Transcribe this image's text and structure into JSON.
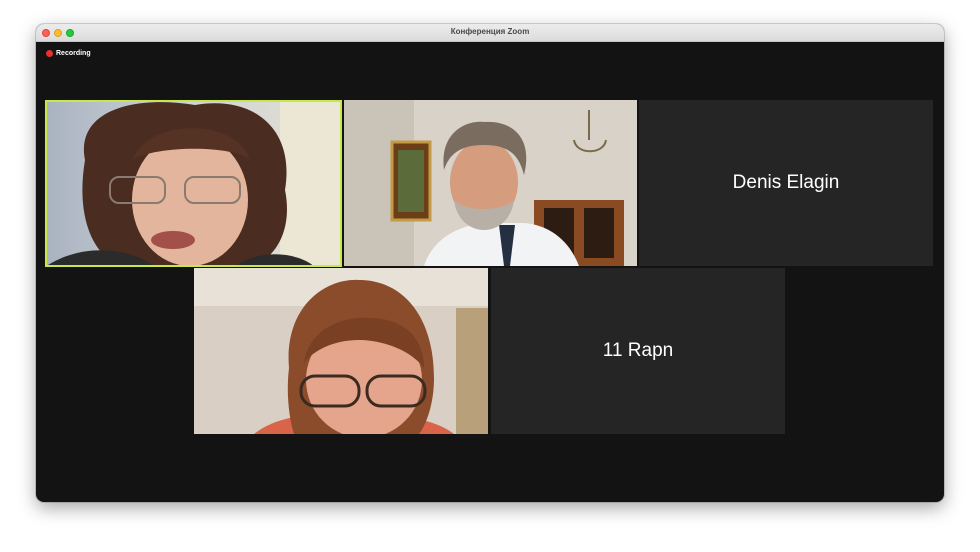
{
  "window": {
    "title": "Конференция Zoom"
  },
  "recording": {
    "label": "Recording",
    "color": "#e5322d"
  },
  "participants": [
    {
      "kind": "video",
      "active": true
    },
    {
      "kind": "video",
      "active": false
    },
    {
      "kind": "name",
      "name": "Denis Elagin"
    },
    {
      "kind": "video",
      "active": false
    },
    {
      "kind": "name",
      "name": "11 Rapn"
    }
  ],
  "colors": {
    "active_speaker_border": "#c8e84a",
    "name_tile_bg": "#252525",
    "window_bg": "#131313"
  }
}
